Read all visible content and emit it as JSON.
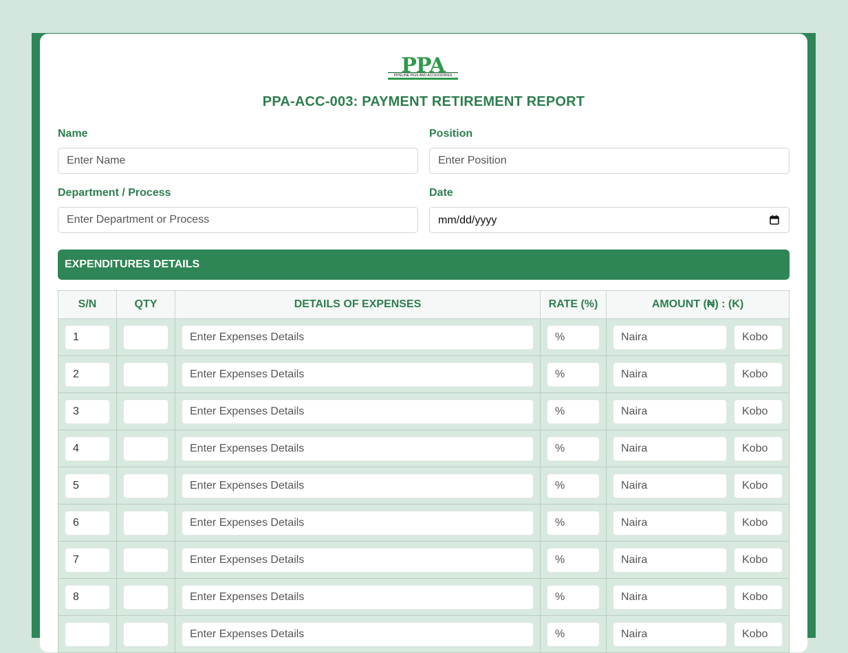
{
  "logo": {
    "text": "PPA",
    "subtext": "PIPELINE PIGS AND ACCESSORIES"
  },
  "title": "PPA-ACC-003: PAYMENT RETIREMENT REPORT",
  "form": {
    "name_label": "Name",
    "name_placeholder": "Enter Name",
    "position_label": "Position",
    "position_placeholder": "Enter Position",
    "department_label": "Department / Process",
    "department_placeholder": "Enter Department or Process",
    "date_label": "Date",
    "date_value": "mm/dd/yyyy"
  },
  "section_title": "EXPENDITURES DETAILS",
  "table": {
    "headers": [
      "S/N",
      "QTY",
      "DETAILS OF EXPENSES",
      "RATE (%)",
      "AMOUNT (₦) : (K)"
    ],
    "placeholders": {
      "details": "Enter Expenses Details",
      "rate": "%",
      "naira": "Naira",
      "kobo": "Kobo"
    },
    "rows": [
      "1",
      "2",
      "3",
      "4",
      "5",
      "6",
      "7",
      "8",
      ""
    ]
  },
  "colors": {
    "accent": "#2e8555",
    "page_bg": "#d4e7dd",
    "row_bg": "#d8e9df"
  }
}
